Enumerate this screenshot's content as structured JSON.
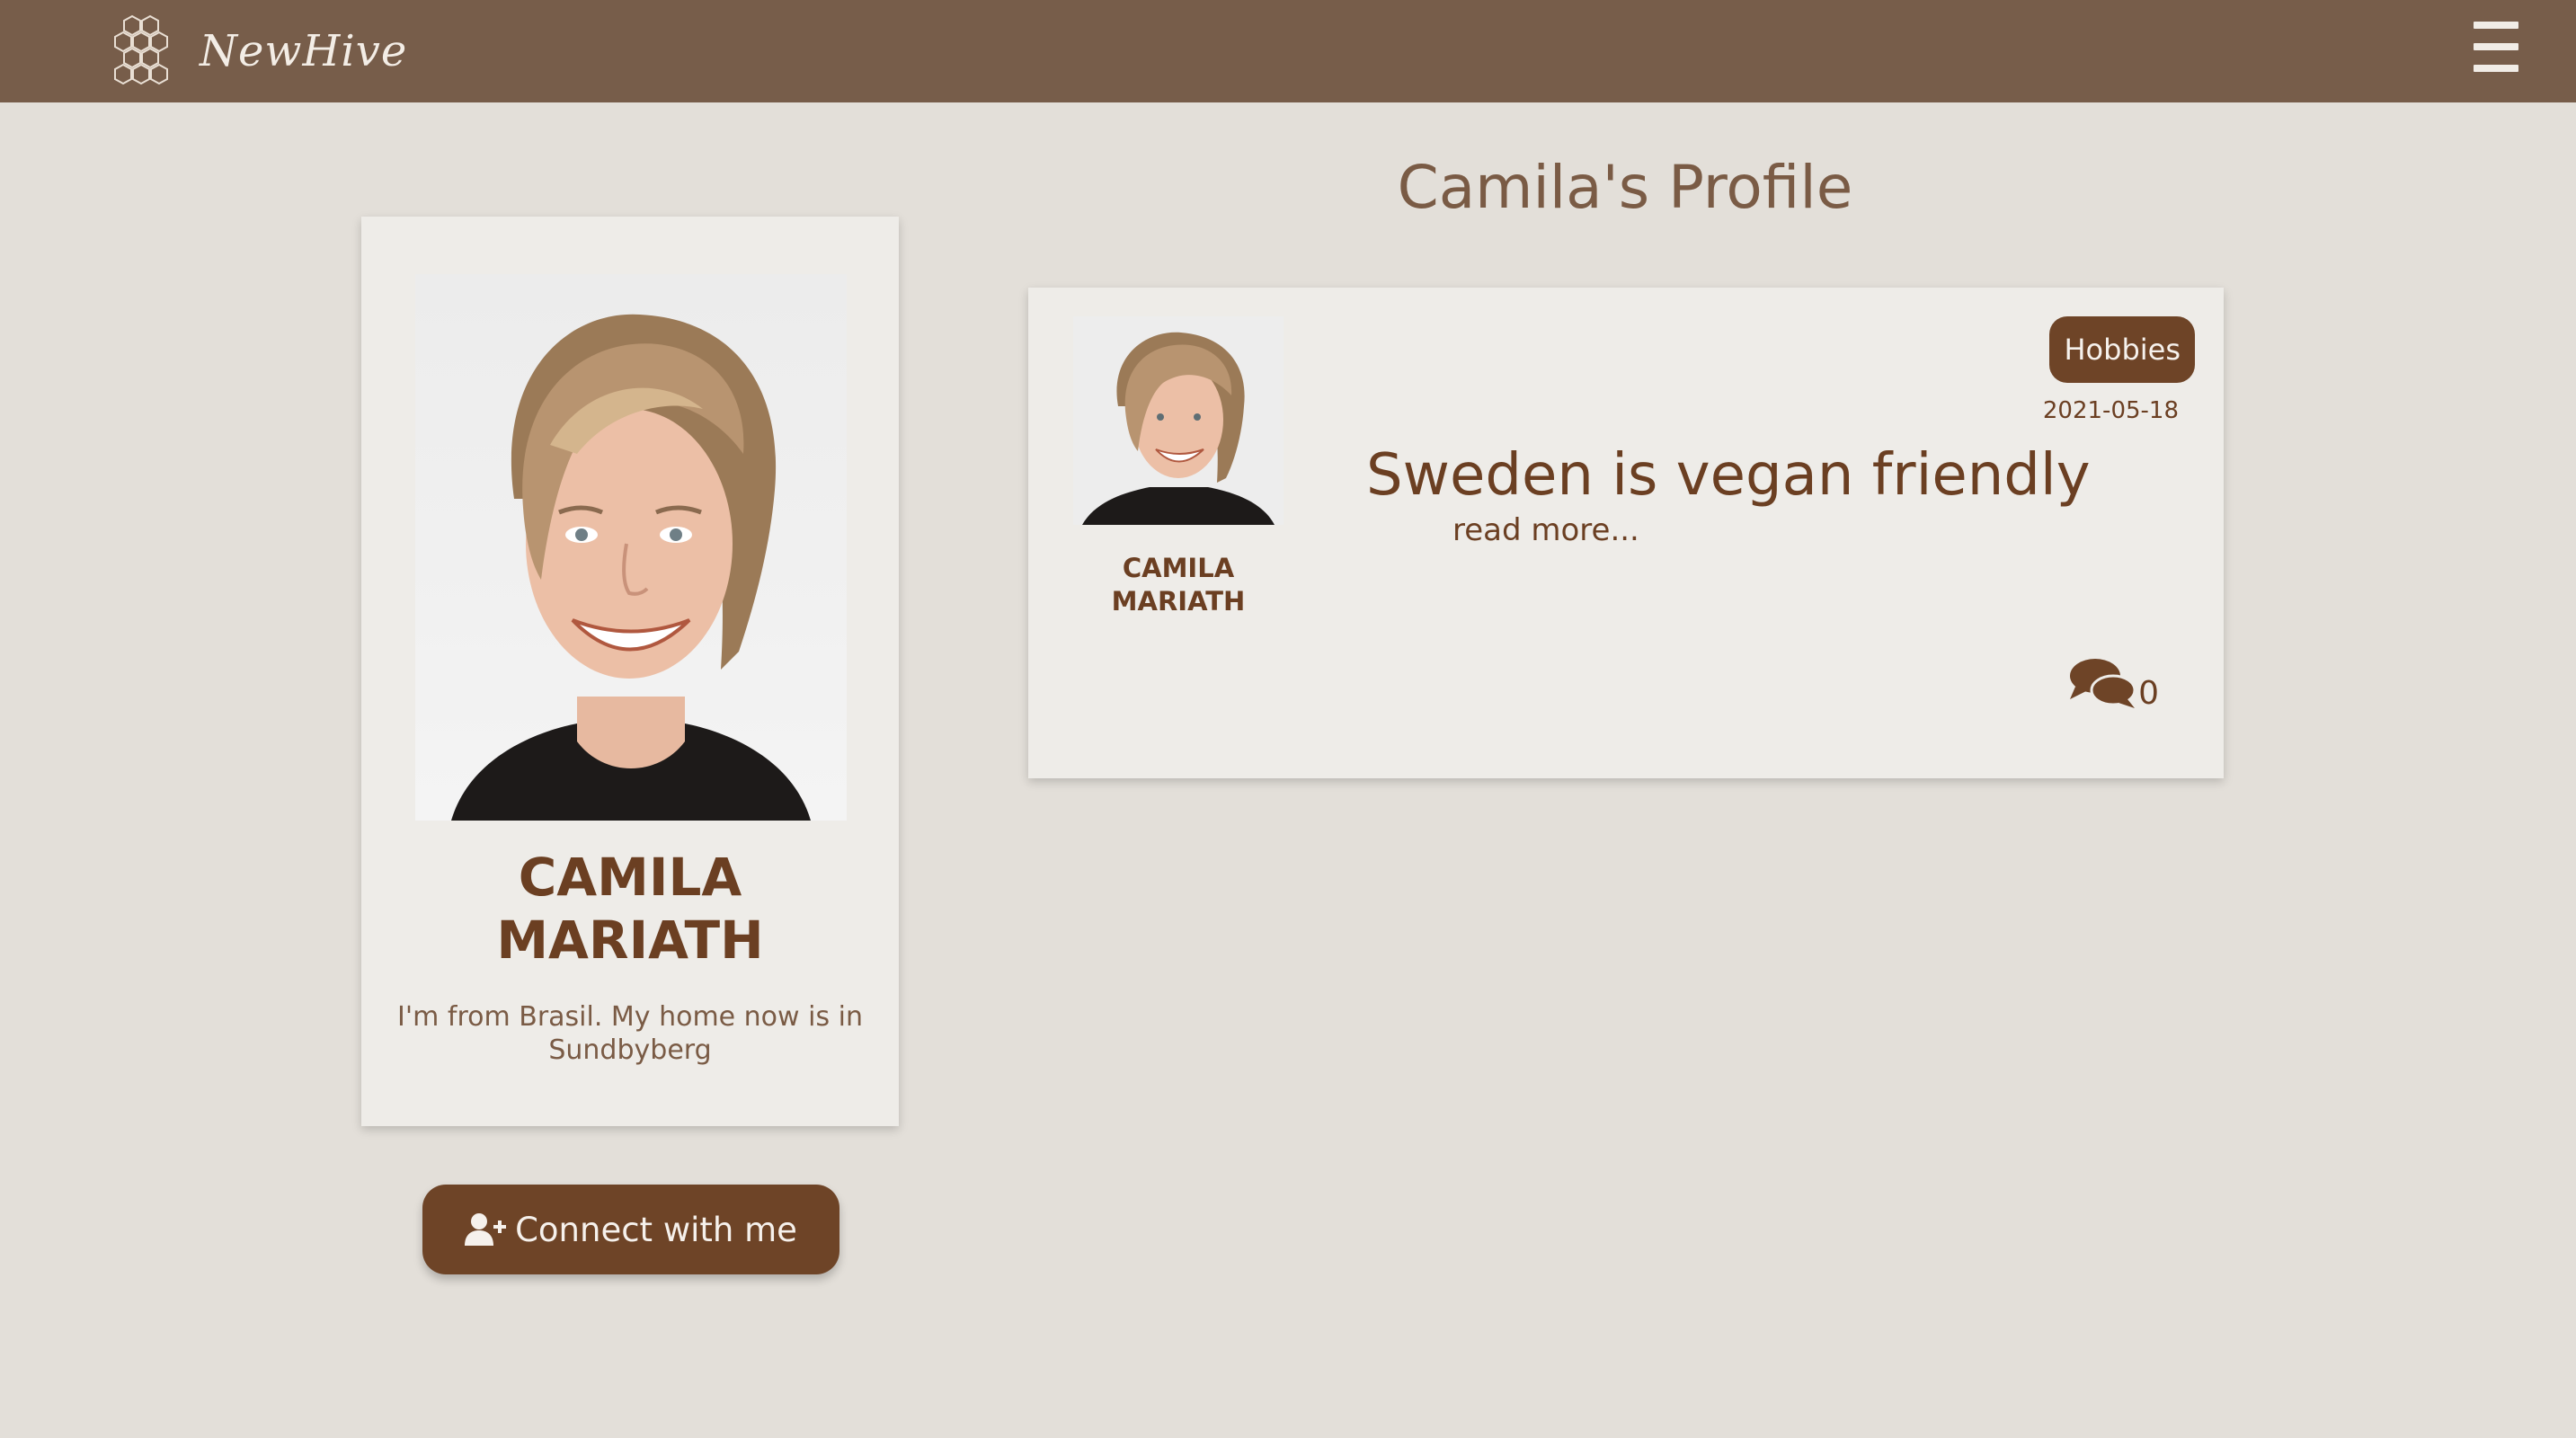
{
  "nav": {
    "brand_name": "NewHive",
    "logo_icon": "honeycomb-icon",
    "menu_icon": "hamburger-menu-icon"
  },
  "page": {
    "title": "Camila's Profile"
  },
  "profile": {
    "name_line1": "CAMILA",
    "name_line2": "MARIATH",
    "bio": "I'm from Brasil. My home now is in Sundbyberg",
    "connect_label": "Connect with me",
    "connect_icon": "user-plus-icon"
  },
  "post": {
    "author_line1": "CAMILA",
    "author_line2": "MARIATH",
    "category": "Hobbies",
    "date": "2021-05-18",
    "title": "Sweden is vegan friendly",
    "read_more": "read more...",
    "comment_icon": "comments-icon",
    "comment_count": "0"
  },
  "colors": {
    "navbar": "#775d4a",
    "background": "#e3dfd9",
    "card": "#eeece8",
    "accent": "#6e4427",
    "text": "#6b3f22"
  }
}
